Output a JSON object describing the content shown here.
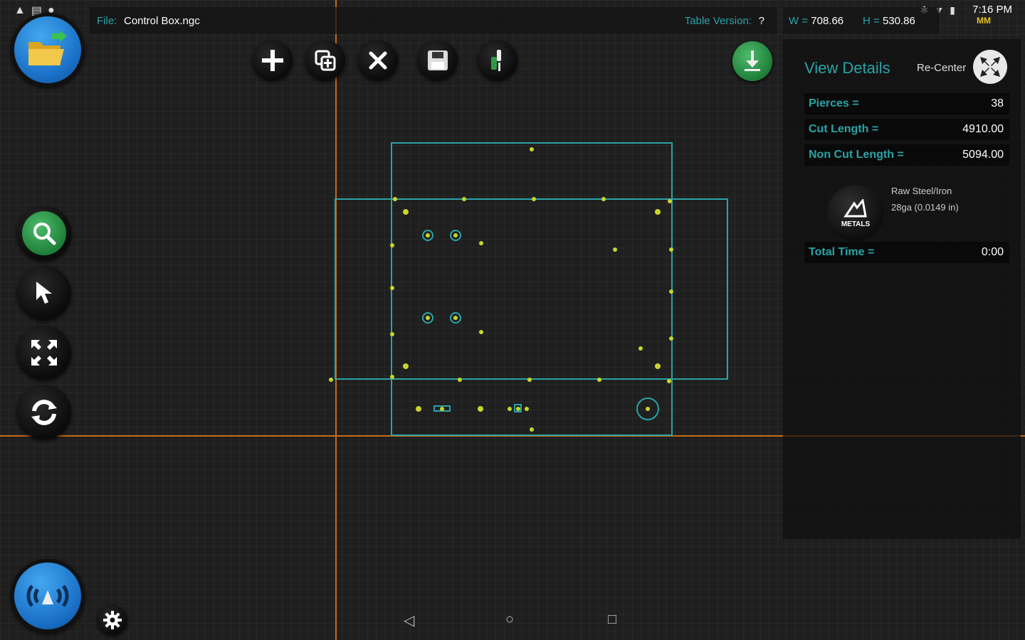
{
  "status_bar": {
    "time": "7:16 PM",
    "unit": "MM",
    "icons": [
      "notification-icon",
      "gallery-icon",
      "record-icon",
      "bluetooth-icon",
      "wifi-icon",
      "battery-icon"
    ]
  },
  "file_bar": {
    "file_label": "File:",
    "file_name": "Control Box.ngc",
    "table_version_label": "Table Version:",
    "table_version_value": "?"
  },
  "dimensions": {
    "w_label": "W =",
    "w_value": "708.66",
    "h_label": "H =",
    "h_value": "530.86"
  },
  "toolbar": {
    "buttons": [
      "add-icon",
      "duplicate-icon",
      "close-icon",
      "save-icon",
      "torch-icon"
    ],
    "download_icon": "download-icon"
  },
  "side_tools": [
    "zoom-icon",
    "select-pointer-icon",
    "fit-view-icon",
    "refresh-icon"
  ],
  "details": {
    "title": "View Details",
    "recenter_label": "Re-Center",
    "pierces_label": "Pierces =",
    "pierces_value": "38",
    "cut_length_label": "Cut Length =",
    "cut_length_value": "4910.00",
    "non_cut_length_label": "Non Cut Length =",
    "non_cut_length_value": "5094.00",
    "material_logo_text": "METALS",
    "material_name": "Raw Steel/Iron",
    "material_gauge": "28ga (0.0149 in)",
    "total_time_label": "Total Time =",
    "total_time_value": "0:00"
  },
  "colors": {
    "accent": "#2aa3a6",
    "guide_line": "#c96a16",
    "pierce_point": "#c8d62a",
    "path_line": "#2aa3a6",
    "primary_button": "#1a70c7",
    "search_button": "#1f7f3a"
  }
}
